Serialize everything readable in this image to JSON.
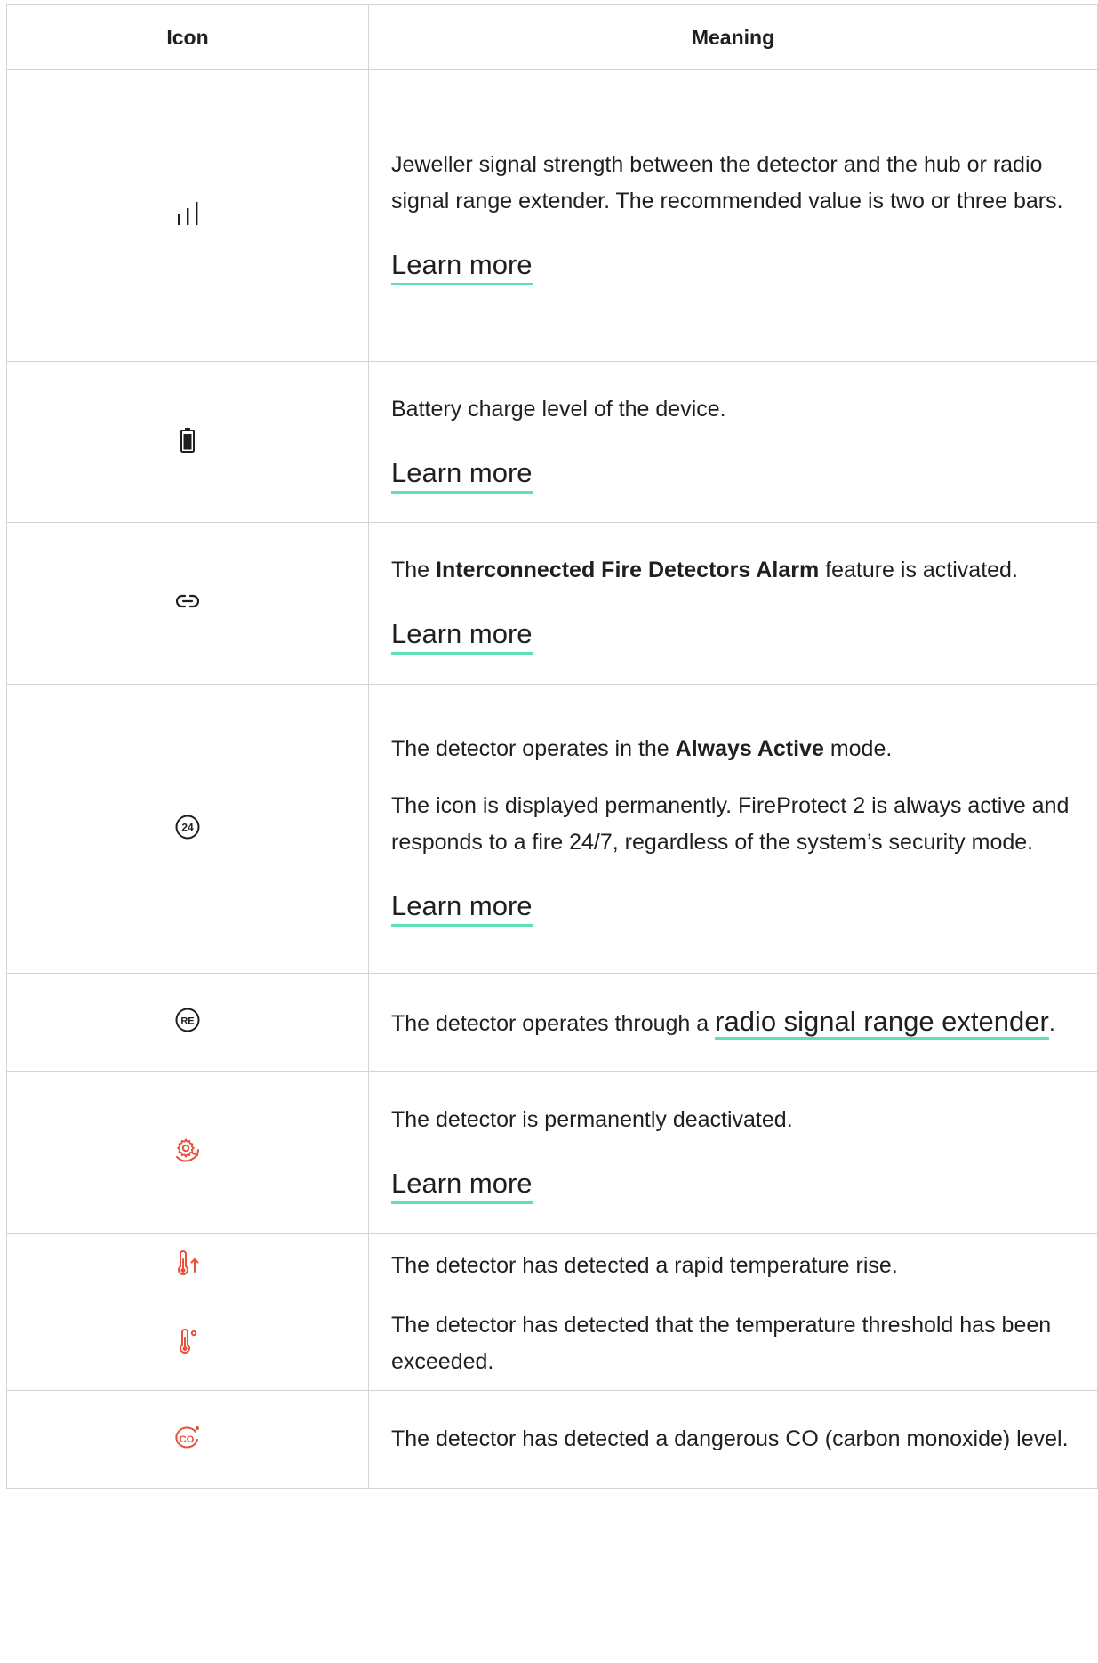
{
  "header": {
    "icon": "Icon",
    "meaning": "Meaning"
  },
  "rows": [
    {
      "icon": "signal-strength-icon",
      "text": "Jeweller signal strength between the detector and the hub or radio signal range extender. The recommended value is two or three bars.",
      "link": "Learn more"
    },
    {
      "icon": "battery-icon",
      "text": "Battery charge level of the device.",
      "link": "Learn more"
    },
    {
      "icon": "link-icon",
      "text_before": "The ",
      "text_bold": "Interconnected Fire Detectors Alarm",
      "text_after": " feature is activated.",
      "link": "Learn more"
    },
    {
      "icon": "always-active-24-icon",
      "icon_label": "24",
      "text_before": "The detector operates in the ",
      "text_bold": "Always Active",
      "text_after": " mode.",
      "text2": "The icon is displayed permanently. FireProtect 2 is always active and responds to a fire 24/7, regardless of the system’s security mode.",
      "link": "Learn more"
    },
    {
      "icon": "range-extender-icon",
      "icon_label": "RE",
      "text_before": "The detector operates through a ",
      "link_inline": "radio signal range extender",
      "text_after": "."
    },
    {
      "icon": "permanently-deactivated-icon",
      "text": "The detector is permanently deactivated.",
      "link": "Learn more"
    },
    {
      "icon": "temperature-rise-icon",
      "text": "The detector has detected a rapid temperature rise."
    },
    {
      "icon": "temperature-threshold-icon",
      "text": "The detector has detected that the temperature threshold has been exceeded."
    },
    {
      "icon": "co-icon",
      "icon_label": "CO",
      "text": "The detector has detected a dangerous CO (carbon monoxide) level."
    }
  ],
  "colors": {
    "alert": "#e8503a",
    "link_underline": "#5fe0b0",
    "border": "#d4d4d4",
    "text": "#1f1f1f"
  }
}
